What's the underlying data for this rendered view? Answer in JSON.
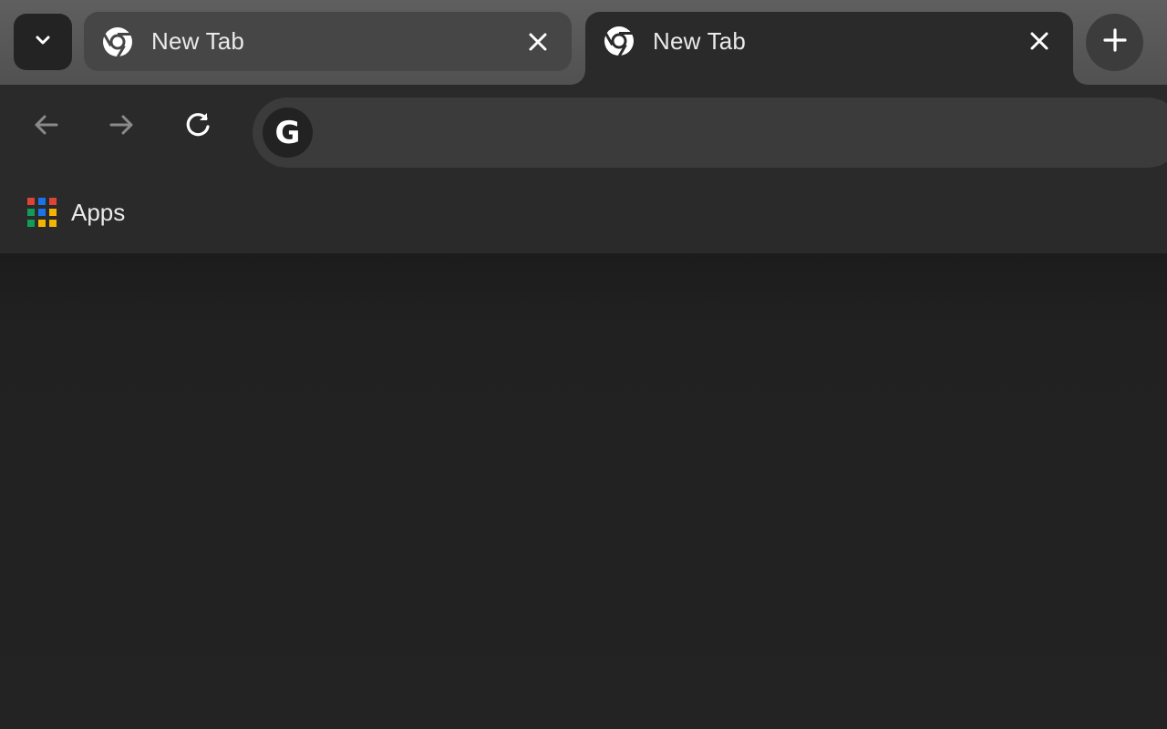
{
  "tabs": [
    {
      "title": "New Tab",
      "active": false,
      "icon": "chrome-icon",
      "close_icon": "close-icon"
    },
    {
      "title": "New Tab",
      "active": true,
      "icon": "chrome-icon",
      "close_icon": "close-icon"
    }
  ],
  "tabstrip": {
    "search_icon": "chevron-down-icon",
    "new_tab_icon": "plus-icon"
  },
  "toolbar": {
    "back_icon": "arrow-left-icon",
    "forward_icon": "arrow-right-icon",
    "reload_icon": "reload-icon",
    "omnibox": {
      "icon": "google-icon",
      "icon_letter": "G",
      "value": "",
      "placeholder": ""
    }
  },
  "bookmarks": {
    "items": [
      {
        "label": "Apps",
        "icon": "apps-grid-icon"
      }
    ]
  },
  "colors": {
    "tabstrip_bg": "#5f5f5f",
    "active_tab_bg": "#2a2a2a",
    "inactive_tab_bg": "#464646",
    "toolbar_bg": "#2a2a2a",
    "omnibox_bg": "#3b3b3b",
    "page_bg": "#222222",
    "text": "#eaeaea",
    "apps_grid": [
      "#db4437",
      "#1a73e8",
      "#db4437",
      "#0f9d58",
      "#1a73e8",
      "#f4b400",
      "#0f9d58",
      "#f4b400",
      "#f4b400"
    ]
  }
}
